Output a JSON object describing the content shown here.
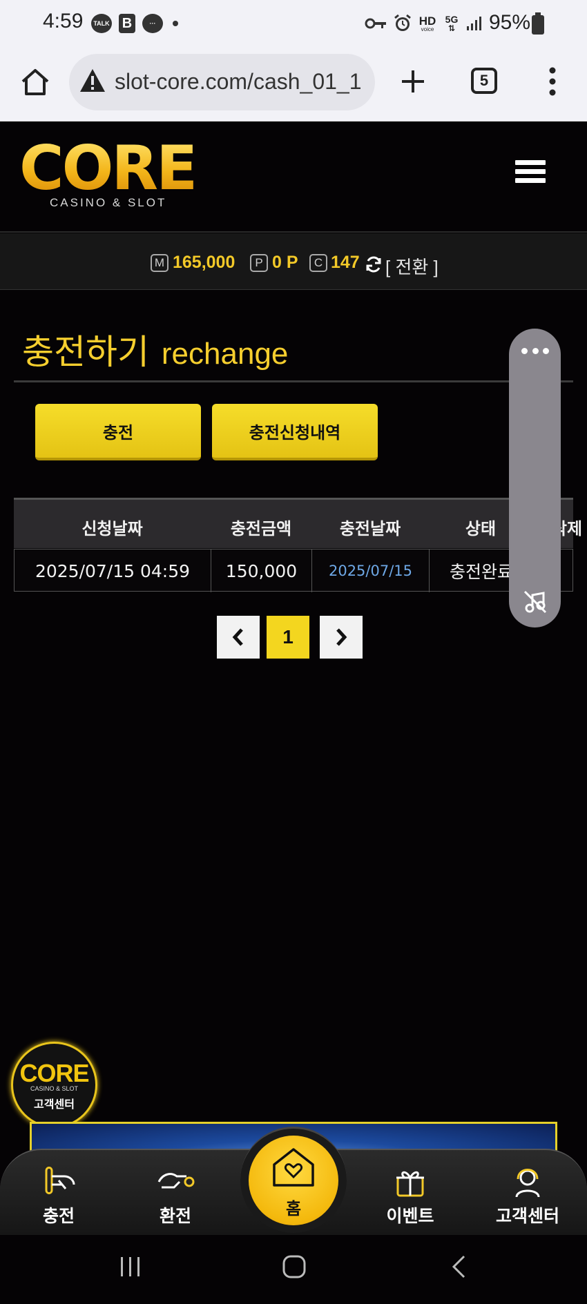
{
  "status_bar": {
    "time": "4:59",
    "notif_talk": "TALK",
    "notif_b": "B",
    "hd_label": "HD",
    "hd_sub": "voice",
    "network": "5G",
    "battery": "95%"
  },
  "browser": {
    "url": "slot-core.com/cash_01_1",
    "tab_count": "5"
  },
  "site": {
    "logo_word": "CORE",
    "logo_sub": "CASINO & SLOT"
  },
  "balance": {
    "money_icon": "M",
    "money": "165,000",
    "point_icon": "P",
    "point": "0 P",
    "coin_icon": "C",
    "coin": "147",
    "switch_label": "[ 전환 ]"
  },
  "page": {
    "title_ko": "충전하기",
    "title_en": "rechange"
  },
  "tabs": {
    "charge": "충전",
    "history": "충전신청내역"
  },
  "table": {
    "headers": [
      "신청날짜",
      "충전금액",
      "충전날짜",
      "상태",
      "삭제"
    ],
    "rows": [
      [
        "2025/07/15 04:59",
        "150,000",
        "2025/07/15",
        "충전완료"
      ]
    ]
  },
  "pagination": {
    "prev": "‹",
    "current": "1",
    "next": "›"
  },
  "support_badge": {
    "word": "CORE",
    "sub": "CASINO & SLOT",
    "label": "고객센터"
  },
  "bottom_nav": {
    "charge": "충전",
    "exchange": "환전",
    "home": "홈",
    "event": "이벤트",
    "support": "고객센터"
  },
  "colors": {
    "accent": "#f3c928",
    "background": "#050305",
    "link_blue": "#6ea8e6"
  }
}
